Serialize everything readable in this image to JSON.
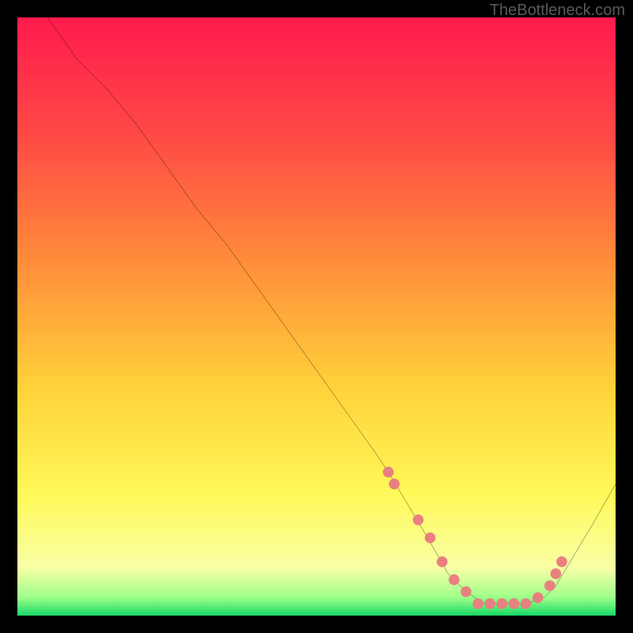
{
  "watermark": "TheBottleneck.com",
  "chart_data": {
    "type": "line",
    "xlabel": "",
    "ylabel": "",
    "xlim": [
      0,
      100
    ],
    "ylim": [
      0,
      100
    ],
    "grid": false,
    "series": [
      {
        "name": "curve",
        "x": [
          5,
          10,
          12,
          15,
          20,
          25,
          30,
          35,
          40,
          45,
          50,
          55,
          60,
          62,
          65,
          68,
          72,
          75,
          78,
          80,
          82,
          85,
          88,
          90,
          93,
          96,
          100
        ],
        "y": [
          100,
          93,
          91,
          88,
          82,
          75,
          68,
          62,
          55,
          48,
          41,
          34,
          27,
          24,
          19,
          14,
          7,
          4,
          2,
          2,
          2,
          2,
          3,
          5,
          10,
          15,
          22
        ]
      },
      {
        "name": "highlight-dots",
        "x": [
          62,
          63,
          67,
          69,
          71,
          73,
          75,
          77,
          79,
          81,
          83,
          85,
          87,
          89,
          90,
          91
        ],
        "y": [
          24,
          22,
          16,
          13,
          9,
          6,
          4,
          2,
          2,
          2,
          2,
          2,
          3,
          5,
          7,
          9
        ]
      }
    ],
    "legend": false,
    "background_gradient": {
      "top": "#ff1a4d",
      "mid1": "#ff8a3a",
      "mid2": "#ffe23a",
      "mid3": "#feff70",
      "bottom": "#17d867"
    }
  }
}
